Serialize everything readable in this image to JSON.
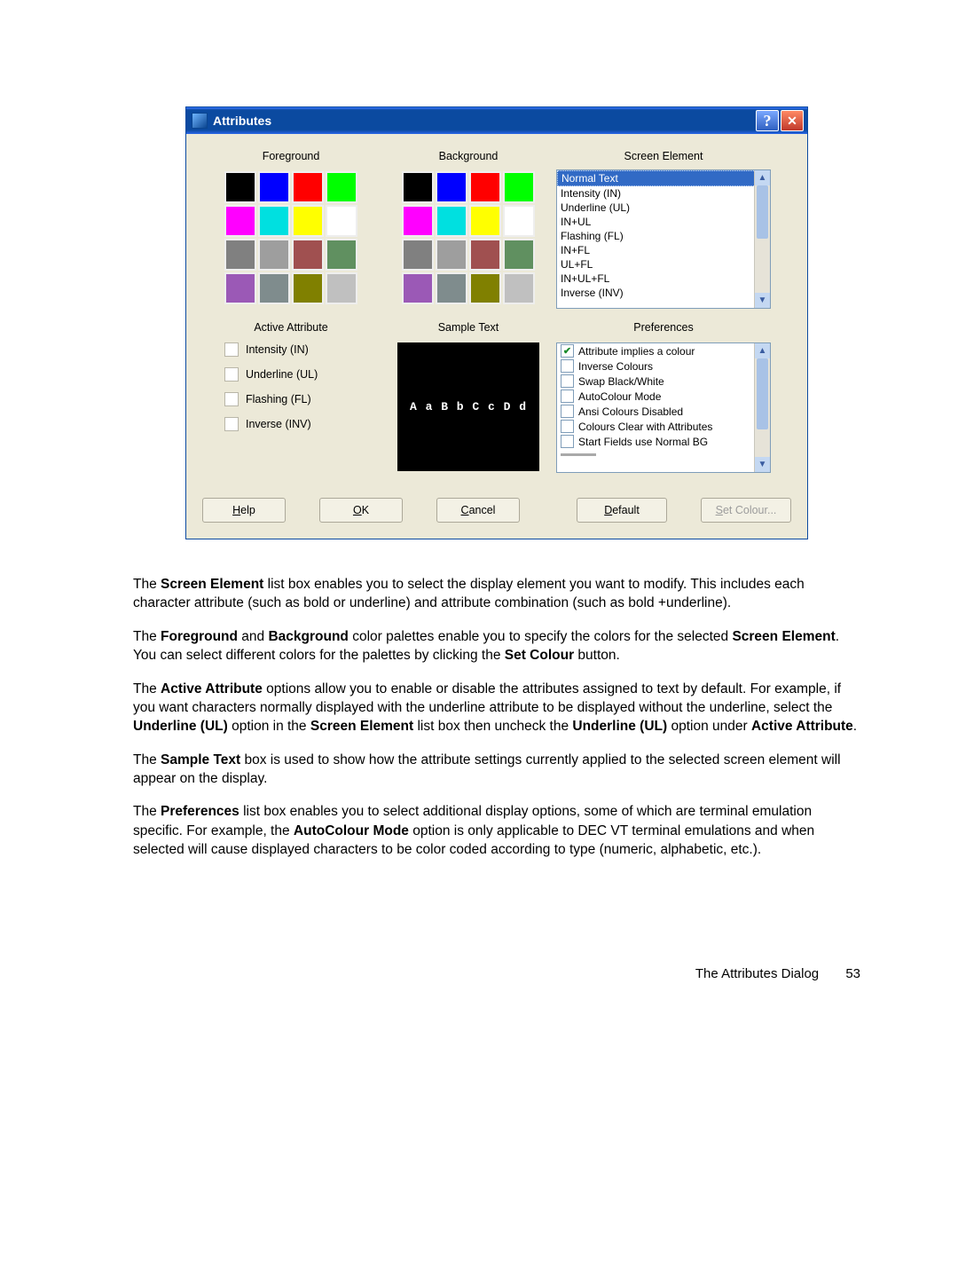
{
  "dialog": {
    "title": "Attributes",
    "headers": {
      "foreground": "Foreground",
      "background": "Background",
      "screen_element": "Screen Element",
      "active_attribute": "Active Attribute",
      "sample_text": "Sample Text",
      "preferences": "Preferences"
    },
    "palette": [
      "#000000",
      "#0000ff",
      "#ff0000",
      "#00ff00",
      "#ff00ff",
      "#00e0e0",
      "#ffff00",
      "#ffffff",
      "#808080",
      "#9e9e9e",
      "#a05050",
      "#609060",
      "#9b59b6",
      "#7f8c8d",
      "#808000",
      "#c0c0c0"
    ],
    "screen_elements": {
      "items": [
        "Normal Text",
        "Intensity (IN)",
        "Underline (UL)",
        "IN+UL",
        "Flashing (FL)",
        "IN+FL",
        "UL+FL",
        "IN+UL+FL",
        "Inverse (INV)"
      ],
      "selected_index": 0
    },
    "active_attributes": [
      "Intensity (IN)",
      "Underline (UL)",
      "Flashing (FL)",
      "Inverse (INV)"
    ],
    "sample_text": "A a B b C c D d",
    "preferences": [
      {
        "label": "Attribute implies a colour",
        "checked": true
      },
      {
        "label": "Inverse Colours",
        "checked": false
      },
      {
        "label": "Swap Black/White",
        "checked": false
      },
      {
        "label": "AutoColour Mode",
        "checked": false
      },
      {
        "label": "Ansi Colours Disabled",
        "checked": false
      },
      {
        "label": "Colours Clear with Attributes",
        "checked": false
      },
      {
        "label": "Start Fields use Normal BG",
        "checked": false
      }
    ],
    "buttons": {
      "help": "Help",
      "ok": "OK",
      "cancel": "Cancel",
      "default": "Default",
      "set_colour": "Set Colour..."
    }
  },
  "paragraphs": {
    "p1a": "The ",
    "p1b": "Screen Element",
    "p1c": " list box enables you to select the display element you want to modify. This includes each character attribute (such as bold or underline) and attribute combination (such as bold +underline).",
    "p2a": "The ",
    "p2b": "Foreground",
    "p2c": " and ",
    "p2d": "Background",
    "p2e": " color palettes enable you to specify the colors for the selected ",
    "p2f": "Screen Element",
    "p2g": ". You can select different colors for the palettes by clicking the ",
    "p2h": "Set Colour",
    "p2i": " button.",
    "p3a": "The ",
    "p3b": "Active Attribute",
    "p3c": " options allow you to enable or disable the attributes assigned to text by default. For example, if you want characters normally displayed with the underline attribute to be displayed without the underline, select the ",
    "p3d": "Underline (UL)",
    "p3e": " option in the ",
    "p3f": "Screen Element",
    "p3g": " list box then uncheck the ",
    "p3h": "Underline (UL)",
    "p3i": " option under ",
    "p3j": "Active Attribute",
    "p3k": ".",
    "p4a": "The ",
    "p4b": "Sample Text",
    "p4c": " box is used to show how the attribute settings currently applied to the selected screen element will appear on the display.",
    "p5a": "The ",
    "p5b": "Preferences",
    "p5c": " list box enables you to select additional display options, some of which are terminal emulation specific. For example, the ",
    "p5d": "AutoColour Mode",
    "p5e": " option is only applicable to DEC VT terminal emulations and when selected will cause displayed characters to be color coded according to type (numeric, alphabetic, etc.)."
  },
  "footer": {
    "section": "The Attributes Dialog",
    "page": "53"
  }
}
